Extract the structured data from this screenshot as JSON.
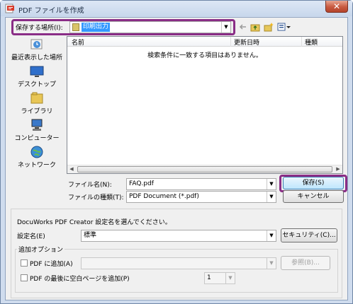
{
  "window": {
    "title": "PDF ファイルを作成",
    "close_glyph": "✕"
  },
  "save_in": {
    "label": "保存する場所(I):",
    "value": "印刷出力",
    "toolbar_icons": [
      "back-arrow-icon",
      "up-folder-icon",
      "new-folder-icon",
      "view-menu-icon"
    ]
  },
  "places": [
    {
      "label": "最近表示した場所",
      "icon": "recent-places-icon"
    },
    {
      "label": "デスクトップ",
      "icon": "desktop-icon"
    },
    {
      "label": "ライブラリ",
      "icon": "libraries-icon"
    },
    {
      "label": "コンピューター",
      "icon": "computer-icon"
    },
    {
      "label": "ネットワーク",
      "icon": "network-icon"
    }
  ],
  "file_list": {
    "columns": [
      "名前",
      "更新日時",
      "種類"
    ],
    "empty_message": "検索条件に一致する項目はありません。"
  },
  "filename": {
    "label": "ファイル名(N):",
    "value": "FAQ.pdf"
  },
  "filetype": {
    "label": "ファイルの種類(T):",
    "value": "PDF Document (*.pdf)"
  },
  "buttons": {
    "save": "保存(S)",
    "cancel": "キャンセル"
  },
  "settings": {
    "instruction": "DocuWorks PDF Creator 設定名を選んでください。",
    "label": "設定名(E)",
    "value": "標準",
    "security_button": "セキュリティ(C)..."
  },
  "add_options": {
    "legend": "追加オプション",
    "append_label": "PDF に追加(A)",
    "append_value": "",
    "browse_button": "参照(B)...",
    "blank_page_label": "PDF の最後に空白ページを追加(P)",
    "blank_page_count": "1"
  },
  "colors": {
    "highlight": "#8a2d86",
    "selection": "#3399ff",
    "frame": "#cfdcee"
  }
}
